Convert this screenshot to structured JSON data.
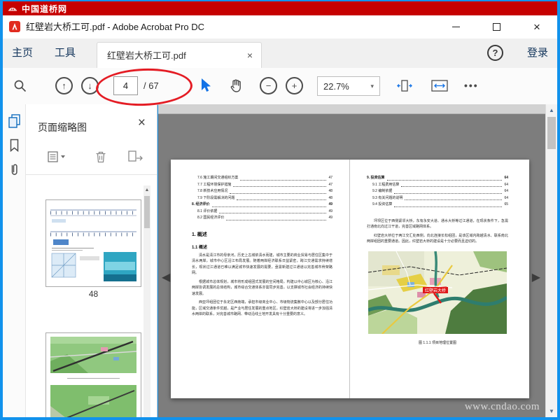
{
  "banner": {
    "site_name": "中国道桥网"
  },
  "window": {
    "title": "红壁岩大桥工可.pdf - Adobe Acrobat Pro DC"
  },
  "tabbar": {
    "home": "主页",
    "tools": "工具",
    "document_tab": "红壁岩大桥工可.pdf",
    "sign_in": "登录"
  },
  "toolbar": {
    "current_page": "4",
    "page_total": "/ 67",
    "zoom_level": "22.7%"
  },
  "sidebar": {
    "panel_title": "页面缩略图",
    "thumb1_label": "48"
  },
  "doc": {
    "left_page": {
      "toc": [
        {
          "label": "7.6 施工期间交通组织方案",
          "page": "47"
        },
        {
          "label": "7.7 工程环境保护措施",
          "page": "47"
        },
        {
          "label": "7.8 新技术应用情况",
          "page": "48"
        },
        {
          "label": "7.9 下阶段需解决的问题",
          "page": "48"
        },
        {
          "label": "8. 经济评价",
          "page": "49"
        },
        {
          "label": "8.1 评价依据",
          "page": "49"
        },
        {
          "label": "8.2 国民经济评价",
          "page": "49"
        }
      ],
      "heading": "1. 概述",
      "subheading": "1.1 概述",
      "p1": "清水是清江市的母亲河，历史上古城依清水而建，城市主要的商业贸易与居住区集中于清水两岸，城市中心区沿江布局发展。随着两岸经济联系日益紧密，跨江交通需求持续增长，现状过江通道已难以满足城市快速发展的需要，亟需新建过江通道以完善城市骨架路网。",
      "p2": "根据城市总体规划，城市将形成组团式发展的空间格局，构建以中心城区为核心、沿江两岸协调发展的总体结构，城市综合交通体系亦需同步完善，以支撑城市社会经济的持续快速发展。",
      "p3": "西亚坪组团位于永定区西南端，承担市级商业中心、市级物流集散中心以及部分居住功能，区域交通条件优越，是产业与居住发展的重点地区。红壁岩大桥的建设将进一步加强清水两岸的联系，对完善城市路网、带动沿线土地开发具有十分重要的意义。"
    },
    "right_page": {
      "toc": [
        {
          "label": "9. 投资估算",
          "page": "64"
        },
        {
          "label": "9.1 工程费用估算",
          "page": "64"
        },
        {
          "label": "9.2 编制依据",
          "page": "64"
        },
        {
          "label": "9.3 有关问题的说明",
          "page": "64"
        },
        {
          "label": "9.4 投资估算",
          "page": "65"
        }
      ],
      "p1": "坪坝区位于西侧紧邻大桥，东有永安大道、通水大桥等过江通道，在现状条件下，急需打通南北向过江干道，完善区域路网体系。",
      "p2": "红壁岩大桥位于两江交汇处西侧，向北连接长松组团，是该区域内跨越清水、联系南北两岸组团的重要通道。因此，红壁岩大桥的建设是十分必要而且迫切的。",
      "figure_caption": "图 1.1.1 项目地理位置图",
      "map_label": "红壁岩大桥"
    }
  },
  "viewer": {
    "watermark": "www.cndao.com"
  },
  "glyphs": {
    "up": "↑",
    "down": "↓",
    "minus": "−",
    "plus": "+",
    "caret": "▾",
    "close": "×",
    "help": "?",
    "more": "•••",
    "scroll_up": "▲",
    "scroll_down": "▼",
    "nav_left": "◀",
    "nav_right": "▶"
  },
  "colors": {
    "frame_blue": "#1192ec",
    "banner_red": "#c60000",
    "accent_blue": "#1473e6",
    "annotation_red": "#e41c24"
  }
}
